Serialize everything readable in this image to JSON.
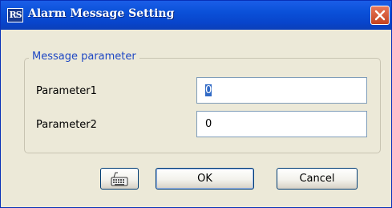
{
  "window": {
    "title": "Alarm Message Setting",
    "app_icon_text": "RS",
    "icons": {
      "app": "rs-app-icon",
      "close": "close-icon"
    }
  },
  "group": {
    "title": "Message parameter",
    "fields": [
      {
        "label": "Parameter1",
        "value": "0",
        "selected": true
      },
      {
        "label": "Parameter2",
        "value": "0",
        "selected": false
      }
    ]
  },
  "buttons": {
    "keyboard_icon": "keyboard-icon",
    "ok_label": "OK",
    "cancel_label": "Cancel"
  },
  "colors": {
    "titlebar": "#0a50d8",
    "group_title": "#1f48c4",
    "close_button": "#d8563a",
    "dialog_bg": "#ece9d8"
  }
}
